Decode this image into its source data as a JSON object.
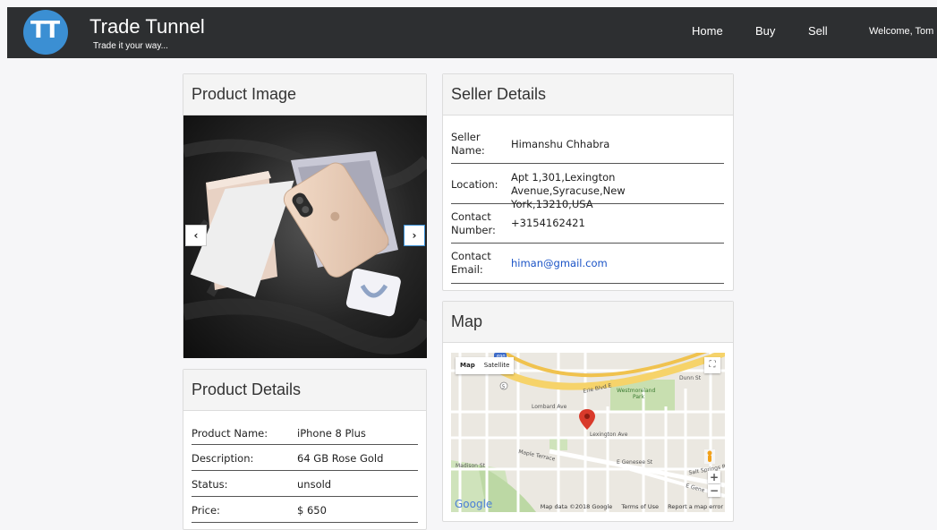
{
  "header": {
    "logo_text": "TT",
    "brand": "Trade Tunnel",
    "tagline": "Trade it your way...",
    "nav": [
      {
        "label": "Home"
      },
      {
        "label": "Buy"
      },
      {
        "label": "Sell"
      }
    ],
    "welcome": "Welcome, Tom"
  },
  "product_image": {
    "title": "Product Image",
    "prev_icon": "‹",
    "next_icon": "›",
    "photo_description_icon": "iphone-box-photo"
  },
  "product_details": {
    "title": "Product Details",
    "rows": [
      {
        "label": "Product Name:",
        "value": "iPhone 8 Plus"
      },
      {
        "label": "Description:",
        "value": "64 GB Rose Gold"
      },
      {
        "label": "Status:",
        "value": "unsold"
      },
      {
        "label": "Price:",
        "value": "$ 650"
      }
    ]
  },
  "seller_details": {
    "title": "Seller Details",
    "rows": [
      {
        "label_1": "Seller",
        "label_2": "Name:",
        "value": "Himanshu Chhabra"
      },
      {
        "label_1": "Location:",
        "value_1": "Apt 1,301,Lexington Avenue,Syracuse,New",
        "value_2": "York,13210,USA"
      },
      {
        "label_1": "Contact",
        "label_2": "Number:",
        "value": "+3154162421"
      },
      {
        "label_1": "Contact",
        "label_2": "Email:",
        "value": "himan@gmail.com"
      }
    ]
  },
  "map": {
    "title": "Map",
    "tabs": [
      "Map",
      "Satellite"
    ],
    "zoom_in": "+",
    "zoom_out": "−",
    "fullscreen_icon": "⛶",
    "logo": "Google",
    "footer": [
      "Map data ©2018 Google",
      "Terms of Use",
      "Report a map error"
    ],
    "labels": {
      "road_1": "Erie Blvd E",
      "park": "Westmoreland",
      "park_2": "Park",
      "ave": "Lexington Ave",
      "street": "E Genesee St",
      "route": "690",
      "route_2": "5",
      "lombard": "Lombard Ave",
      "maple": "Maple Terrace",
      "madison": "Madison St",
      "salt": "Salt Springs R",
      "dunn": "Dunn St",
      "genesee_short": "E Gene"
    },
    "accent": "#e53935"
  },
  "colors": {
    "navbar": "#2d2f31",
    "logo": "#3b8fd3",
    "email": "#1a53c6"
  }
}
